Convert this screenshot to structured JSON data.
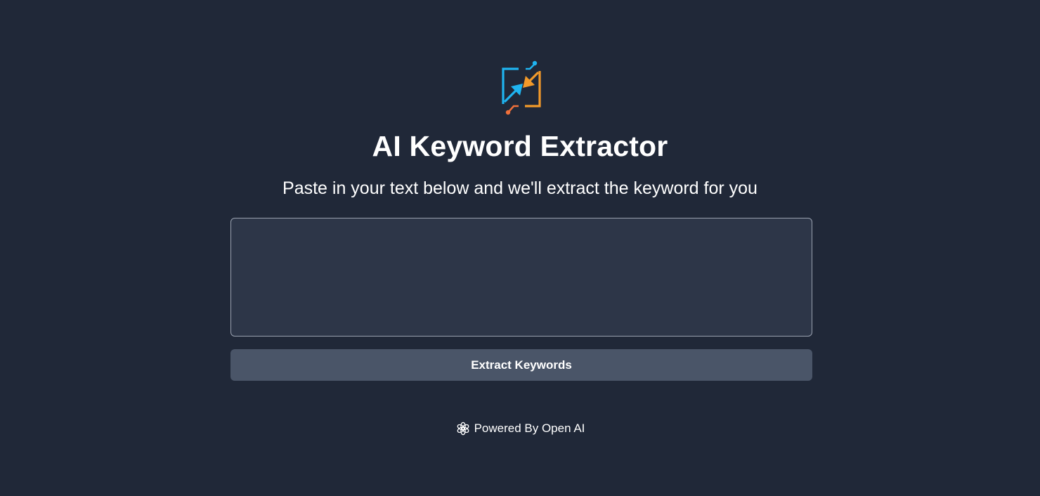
{
  "app": {
    "logo_icon": "keyword-extractor-logo-icon",
    "title": "AI Keyword Extractor",
    "subtitle": "Paste in your text below and we'll extract the keyword for you"
  },
  "input": {
    "value": "",
    "placeholder": ""
  },
  "actions": {
    "extract_label": "Extract Keywords"
  },
  "footer": {
    "icon": "openai-icon",
    "text": "Powered By Open AI"
  },
  "colors": {
    "background": "#202838",
    "textarea_bg": "#2d3648",
    "button_bg": "#4a5568",
    "logo_blue": "#1fb4f0",
    "logo_orange": "#f39a2a"
  }
}
